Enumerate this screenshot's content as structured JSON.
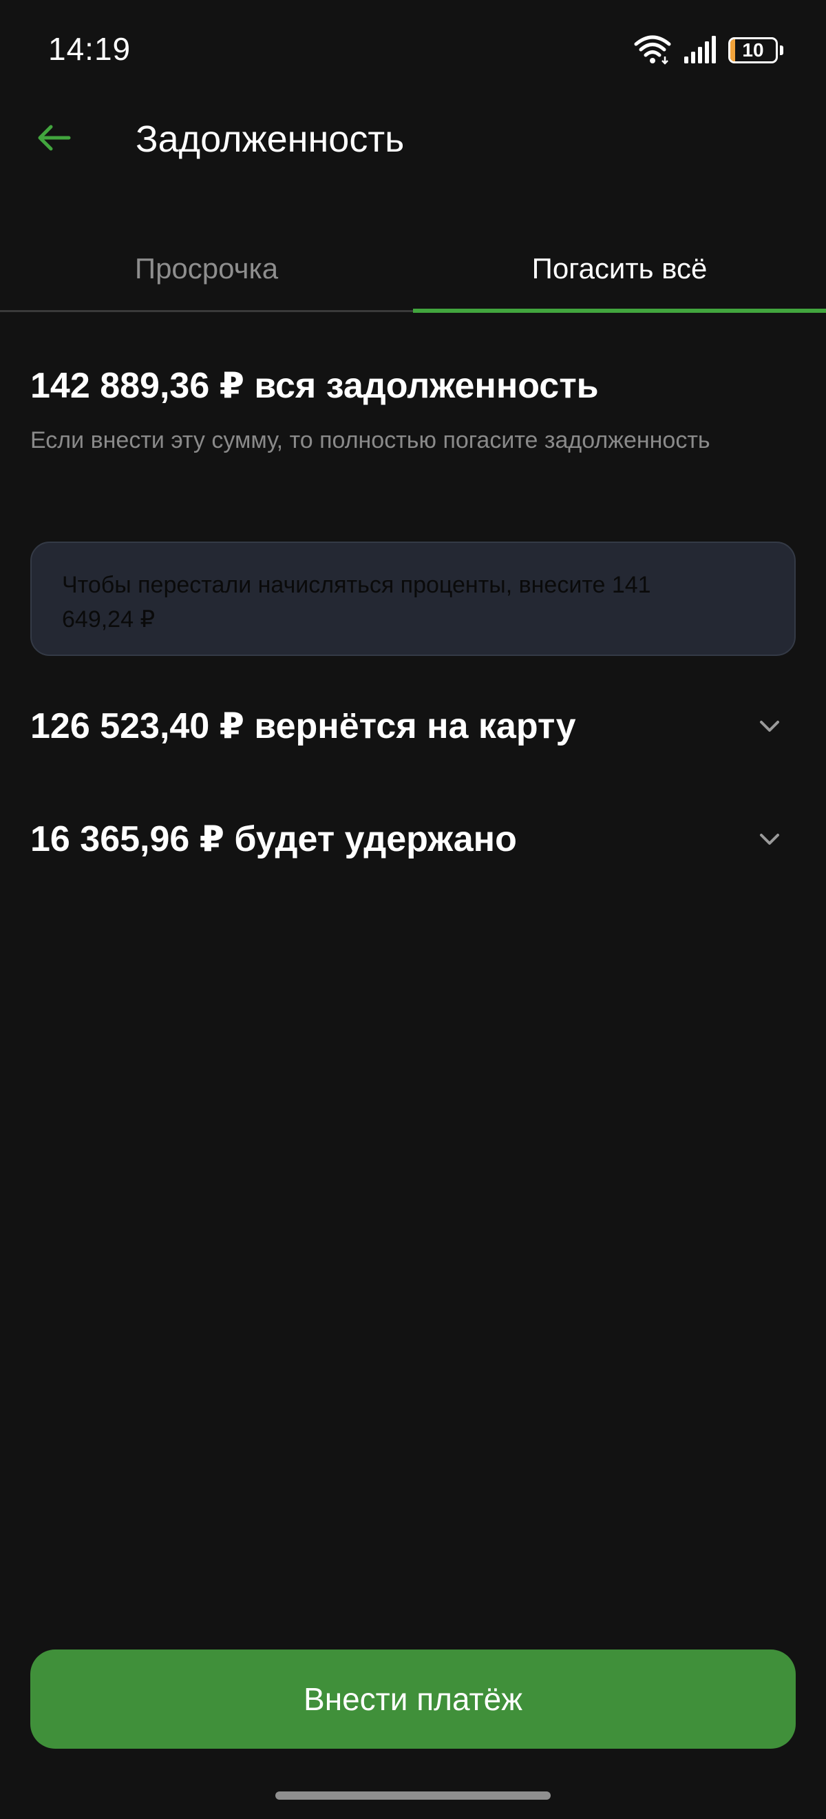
{
  "status_bar": {
    "time": "14:19",
    "battery_level": "10",
    "battery_fraction": 0.1,
    "icons": [
      "wifi-icon",
      "signal-icon",
      "battery-icon"
    ],
    "battery_color": "#f2a33a"
  },
  "header": {
    "back_icon": "arrow-left-icon",
    "title": "Задолженность"
  },
  "tabs": [
    {
      "label": "Просрочка",
      "selected": false
    },
    {
      "label": "Погасить всё",
      "selected": true
    }
  ],
  "summary": {
    "title": "142 889,36 ₽ вся задолженность",
    "subtitle": "Если внести эту сумму, то полностью погасите задолженность"
  },
  "info_card": {
    "text": "Чтобы перестали начисляться проценты, внесите 141 649,24 ₽"
  },
  "rows": [
    {
      "label": "126 523,40 ₽ вернётся на карту",
      "icon": "chevron-down-icon"
    },
    {
      "label": "16 365,96 ₽ будет удержано",
      "icon": "chevron-down-icon"
    }
  ],
  "pay_button": {
    "label": "Внести платёж"
  },
  "colors": {
    "background": "#121212",
    "accent": "#42a53e",
    "button": "#40903a",
    "card": "#242833"
  }
}
